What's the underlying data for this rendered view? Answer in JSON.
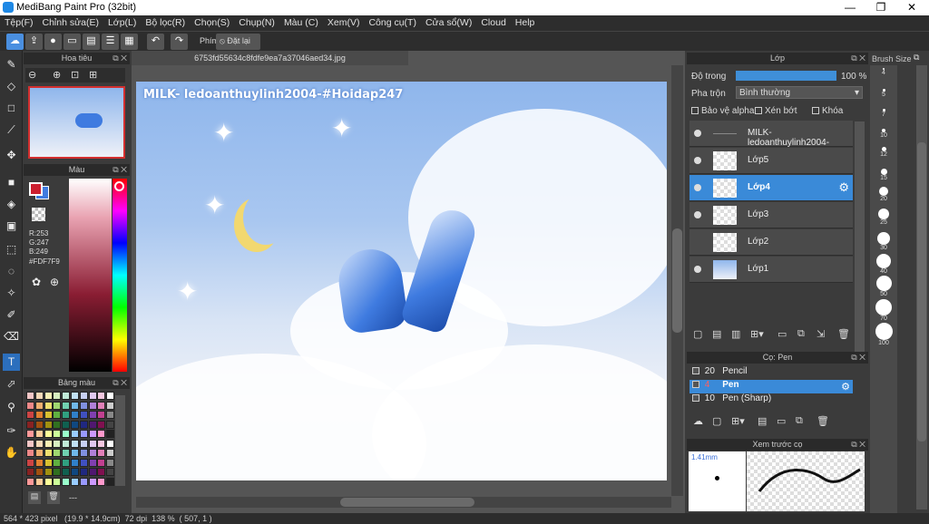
{
  "window": {
    "title": "MediBang Paint Pro (32bit)"
  },
  "menu": [
    "Tệp(F)",
    "Chỉnh sửa(E)",
    "Lớp(L)",
    "Bộ lọc(R)",
    "Chọn(S)",
    "Chụp(N)",
    "Màu (C)",
    "Xem(V)",
    "Công cụ(T)",
    "Cửa sổ(W)",
    "Cloud",
    "Help"
  ],
  "toolbar": {
    "phim_label": "Phím",
    "reset_label": "Đặt lại"
  },
  "navigator": {
    "title": "Hoa tiêu"
  },
  "color_panel": {
    "title": "Màu",
    "rgb": [
      "R:253",
      "G:247",
      "B:249"
    ],
    "hex": "#FDF7F9",
    "fg_color": "#cc1f2f",
    "bg_color": "#3f7be0"
  },
  "palette": {
    "title": "Bảng màu",
    "footer": "---"
  },
  "canvas": {
    "filename": "6753fd55634c8fdfe9ea7a37046aed34.jpg",
    "watermark": "MILK- ledoanthuylinh2004-#Hoidap247"
  },
  "layers": {
    "title": "Lớp",
    "opacity_label": "Độ trong",
    "opacity_value": "100 %",
    "blend_label": "Pha trộn",
    "blend_value": "Bình thường",
    "protect_alpha": "Bảo vệ alpha",
    "clipping": "Xén bớt",
    "lock": "Khóa",
    "items": [
      {
        "name": "MILK- ledoanthuylinh2004-"
      },
      {
        "name": "Lớp5"
      },
      {
        "name": "Lớp4",
        "selected": true
      },
      {
        "name": "Lớp3"
      },
      {
        "name": "Lớp2"
      },
      {
        "name": "Lớp1"
      }
    ]
  },
  "brushes": {
    "title": "Cọ: Pen",
    "items": [
      {
        "size": "20",
        "name": "Pencil"
      },
      {
        "size": "4",
        "name": "Pen",
        "selected": true
      },
      {
        "size": "10",
        "name": "Pen (Sharp)"
      }
    ]
  },
  "preview": {
    "title": "Xem trước cọ",
    "size": "1.41mm"
  },
  "brush_size": {
    "title": "Brush Size",
    "values": [
      "4",
      "5",
      "7",
      "10",
      "12",
      "15",
      "20",
      "25",
      "30",
      "40",
      "50",
      "70",
      "100"
    ]
  },
  "status": {
    "text": "564 * 423 pixel   (19.9 * 14.9cm)  72 dpi  138 %  ( 507, 1 )"
  }
}
